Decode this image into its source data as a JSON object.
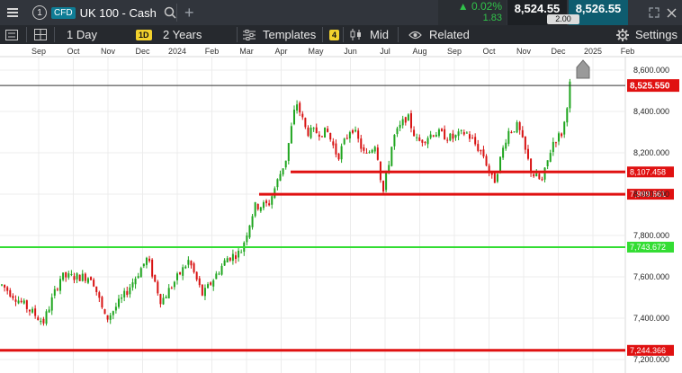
{
  "topbar": {
    "tab_number": "1",
    "instrument_type": "CFD",
    "instrument_name": "UK 100 - Cash",
    "change_pct": "0.02%",
    "change_abs": "1.83",
    "sell_price": "8,524.55",
    "buy_price": "8,526.55",
    "spread": "2.00"
  },
  "toolbar": {
    "interval": "1 Day",
    "interval_badge": "1D",
    "range": "2 Years",
    "templates": "Templates",
    "indicator_count": "4",
    "price_type": "Mid",
    "related": "Related",
    "settings": "Settings"
  },
  "colors": {
    "up": "#1fa51f",
    "down": "#d81212",
    "support_line": "#e01111",
    "green_line": "#33dd33",
    "toolbar_bg": "#26292e",
    "topbar_bg": "#31353c"
  },
  "chart_data": {
    "type": "candlestick",
    "x_ticks": [
      "Sep",
      "Oct",
      "Nov",
      "Dec",
      "2024",
      "Feb",
      "Mar",
      "Apr",
      "May",
      "Jun",
      "Jul",
      "Aug",
      "Sep",
      "Oct",
      "Nov",
      "Dec",
      "2025",
      "Feb"
    ],
    "y_ticks": [
      "8,600.000",
      "8,400.000",
      "8,200.000",
      "8,000.000",
      "7,800.000",
      "7,600.000",
      "7,400.000",
      "7,200.000"
    ],
    "ylim": [
      7200,
      8600
    ],
    "grid": true,
    "current_price": {
      "value": 8525.55,
      "label": "8,525.550"
    },
    "horizontal_lines": [
      {
        "value": 8107.458,
        "label": "8,107.458",
        "color": "red"
      },
      {
        "value": 7999.661,
        "label": "7,999.661",
        "color": "red"
      },
      {
        "value": 7743.672,
        "label": "7,743.672",
        "color": "green"
      },
      {
        "value": 7244.366,
        "label": "7,244.366",
        "color": "red"
      }
    ],
    "price_path": [
      {
        "x": 0.0,
        "v": 7560
      },
      {
        "x": 1.2,
        "v": 7380
      },
      {
        "x": 1.7,
        "v": 7600
      },
      {
        "x": 2.6,
        "v": 7600
      },
      {
        "x": 3.0,
        "v": 7390
      },
      {
        "x": 3.5,
        "v": 7500
      },
      {
        "x": 4.2,
        "v": 7690
      },
      {
        "x": 4.6,
        "v": 7480
      },
      {
        "x": 5.4,
        "v": 7680
      },
      {
        "x": 5.8,
        "v": 7510
      },
      {
        "x": 6.5,
        "v": 7690
      },
      {
        "x": 6.9,
        "v": 7720
      },
      {
        "x": 7.3,
        "v": 7940
      },
      {
        "x": 7.7,
        "v": 7950
      },
      {
        "x": 8.2,
        "v": 8170
      },
      {
        "x": 8.5,
        "v": 8450
      },
      {
        "x": 8.8,
        "v": 8300
      },
      {
        "x": 9.4,
        "v": 8300
      },
      {
        "x": 9.7,
        "v": 8180
      },
      {
        "x": 10.1,
        "v": 8330
      },
      {
        "x": 10.5,
        "v": 8180
      },
      {
        "x": 10.8,
        "v": 8250
      },
      {
        "x": 11.0,
        "v": 8000
      },
      {
        "x": 11.3,
        "v": 8270
      },
      {
        "x": 11.7,
        "v": 8380
      },
      {
        "x": 12.0,
        "v": 8250
      },
      {
        "x": 12.5,
        "v": 8300
      },
      {
        "x": 13.0,
        "v": 8270
      },
      {
        "x": 13.4,
        "v": 8300
      },
      {
        "x": 13.9,
        "v": 8190
      },
      {
        "x": 14.2,
        "v": 8050
      },
      {
        "x": 14.6,
        "v": 8300
      },
      {
        "x": 14.9,
        "v": 8330
      },
      {
        "x": 15.3,
        "v": 8100
      },
      {
        "x": 15.6,
        "v": 8060
      },
      {
        "x": 15.9,
        "v": 8250
      },
      {
        "x": 16.2,
        "v": 8300
      },
      {
        "x": 16.4,
        "v": 8530
      }
    ]
  }
}
